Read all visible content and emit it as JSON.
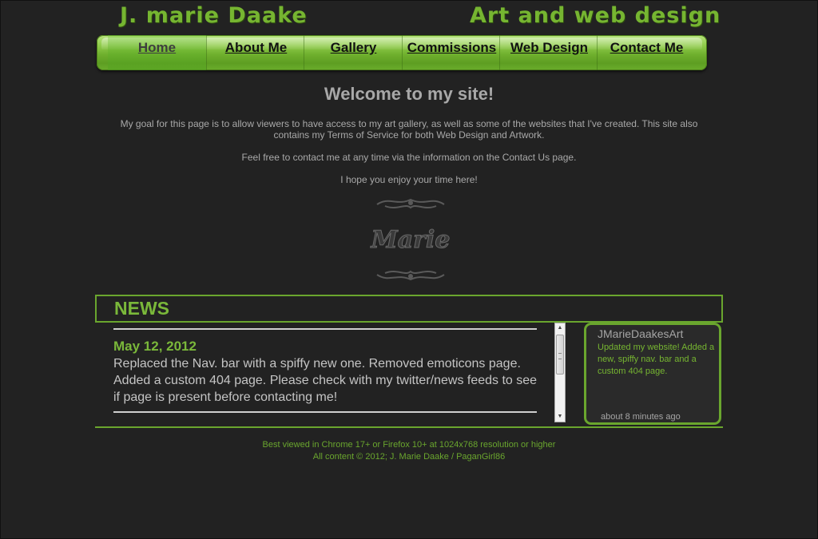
{
  "header": {
    "site_name": "J. marie Daake",
    "tagline": "Art and web design"
  },
  "nav": {
    "items": [
      {
        "label": "Home",
        "active": true
      },
      {
        "label": "About Me"
      },
      {
        "label": "Gallery"
      },
      {
        "label": "Commissions"
      },
      {
        "label": "Web Design"
      },
      {
        "label": "Contact Me"
      }
    ],
    "color": "#76b531"
  },
  "welcome": {
    "title": "Welcome to my site!",
    "paragraph1": "My goal for this page is to allow viewers to have access to my art gallery, as well as some of the websites that I've created. This site also contains my Terms of Service for both Web Design and Artwork.",
    "paragraph2": "Feel free to contact me at any time via the information on the Contact Us page.",
    "paragraph3": "I hope you enjoy your time here!",
    "signature_text": "Marie"
  },
  "news": {
    "title": "NEWS",
    "entries": [
      {
        "date": "May 12, 2012",
        "body": "Replaced the Nav. bar with a spiffy new one. Removed emoticons page. Added a custom 404 page. Please check with my twitter/news feeds to see if page is present before contacting me!"
      }
    ]
  },
  "twitter": {
    "user": "JMarieDaakesArt",
    "text": "Updated my website! Added a new, spiffy nav. bar and a custom 404 page.",
    "time": "about 8 minutes ago"
  },
  "footer": {
    "line1": "Best viewed in Chrome 17+ or Firefox 10+ at 1024x768 resolution or higher",
    "line2": "All content © 2012;  J. Marie Daake / PaganGirl86"
  },
  "colors": {
    "background": "#222222",
    "accent": "#76b531",
    "text": "#a9a9a9"
  }
}
